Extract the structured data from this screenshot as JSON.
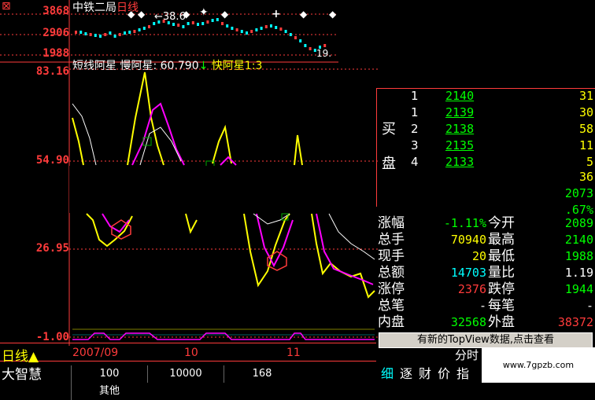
{
  "top": {
    "stock_name": "中铁二局",
    "period": "日线",
    "axis": [
      "3868",
      "2906",
      "1988"
    ],
    "low_marker": "19.",
    "high_marker": "38.6"
  },
  "indicator": {
    "name": "短线阿星",
    "slow_label": "慢阿星:",
    "slow_value": "60.790",
    "fast_label": "快阿星1:",
    "fast_value": "3",
    "axis": [
      "83.16",
      "54.90",
      "26.95",
      "-1.00"
    ]
  },
  "orderbook": {
    "buy_label": [
      "买",
      "盘"
    ],
    "rows": [
      {
        "level": "1",
        "price": "2140",
        "vol": "31"
      },
      {
        "level": "1",
        "price": "2139",
        "vol": "30"
      },
      {
        "level": "2",
        "price": "2138",
        "vol": "58"
      },
      {
        "level": "3",
        "price": "2135",
        "vol": "11"
      },
      {
        "level": "4",
        "price": "2133",
        "vol": "5"
      }
    ],
    "extra": [
      "36",
      "2073",
      ".67%"
    ]
  },
  "stats": {
    "rows": [
      {
        "l1": "涨幅",
        "v1": "-1.11%",
        "c1": "#00ff00",
        "l2": "今开",
        "v2": "2089",
        "c2": "#00ff00"
      },
      {
        "l1": "总手",
        "v1": "70940",
        "c1": "#ffff00",
        "l2": "最高",
        "v2": "2140",
        "c2": "#00ff00"
      },
      {
        "l1": "现手",
        "v1": "20",
        "c1": "#ffff00",
        "l2": "最低",
        "v2": "1988",
        "c2": "#00ff00"
      },
      {
        "l1": "总额",
        "v1": "14703",
        "c1": "#00ffff",
        "l2": "量比",
        "v2": "1.19",
        "c2": "#ffffff"
      },
      {
        "l1": "涨停",
        "v1": "2376",
        "c1": "#ff3b3b",
        "l2": "跌停",
        "v2": "1944",
        "c2": "#00ff00"
      },
      {
        "l1": "总笔",
        "v1": "-",
        "c1": "#ffffff",
        "l2": "每笔",
        "v2": "-",
        "c2": "#ffffff"
      },
      {
        "l1": "内盘",
        "v1": "32568",
        "c1": "#00ff00",
        "l2": "外盘",
        "v2": "38372",
        "c2": "#ff3b3b"
      }
    ]
  },
  "banner": {
    "text": "有新的TopView数据,点击查看"
  },
  "bottom": {
    "period_label": "日线",
    "app_name": "大智慧",
    "dates": [
      "2007/09",
      "10",
      "11"
    ],
    "tabs": [
      "100",
      "10000",
      "168",
      "其他"
    ],
    "right_tabs": [
      "细",
      "逐",
      "财",
      "价",
      "指"
    ],
    "fenshi": "分时",
    "watermark": "www.7gpzb.com"
  },
  "colors": {
    "up": "#ff3b3b",
    "down": "#00ffff",
    "slow": "#ff00ff",
    "fast": "#ffff00",
    "accent": "#ff0000"
  }
}
